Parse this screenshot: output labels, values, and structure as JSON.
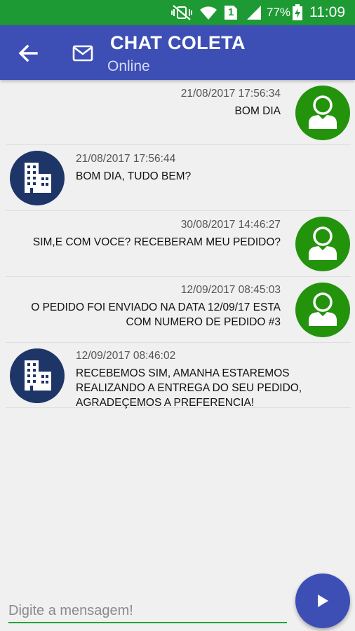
{
  "status_bar": {
    "battery_percent": "77%",
    "time": "11:09",
    "sim_label": "1",
    "color": "#1e9a34"
  },
  "app_bar": {
    "title": "CHAT COLETA",
    "subtitle": "Online",
    "color": "#3d4fb5"
  },
  "messages": [
    {
      "side": "sent",
      "sender": "user",
      "timestamp": "21/08/2017 17:56:34",
      "text": "BOM DIA"
    },
    {
      "side": "received",
      "sender": "company",
      "timestamp": "21/08/2017 17:56:44",
      "text": "BOM DIA, TUDO BEM?"
    },
    {
      "side": "sent",
      "sender": "user",
      "timestamp": "30/08/2017 14:46:27",
      "text": "SIM,E COM VOCE? RECEBERAM MEU PEDIDO?"
    },
    {
      "side": "sent",
      "sender": "user",
      "timestamp": "12/09/2017 08:45:03",
      "text": "O PEDIDO FOI ENVIADO NA DATA 12/09/17 ESTA\nCOM NUMERO DE PEDIDO #3"
    },
    {
      "side": "received",
      "sender": "company",
      "timestamp": "12/09/2017 08:46:02",
      "text": "RECEBEMOS SIM, AMANHA ESTAREMOS\nREALIZANDO A ENTREGA DO SEU PEDIDO,\nAGRADEÇEMOS A PREFERENCIA!"
    }
  ],
  "composer": {
    "placeholder": "Digite a mensagem!",
    "value": ""
  },
  "icons": {
    "back": "arrow-left-icon",
    "mail": "envelope-icon",
    "send": "send-icon",
    "user_avatar": "person-icon",
    "company_avatar": "building-icon"
  },
  "colors": {
    "user_avatar": "#23930c",
    "company_avatar": "#1e3568",
    "accent": "#22a335"
  }
}
